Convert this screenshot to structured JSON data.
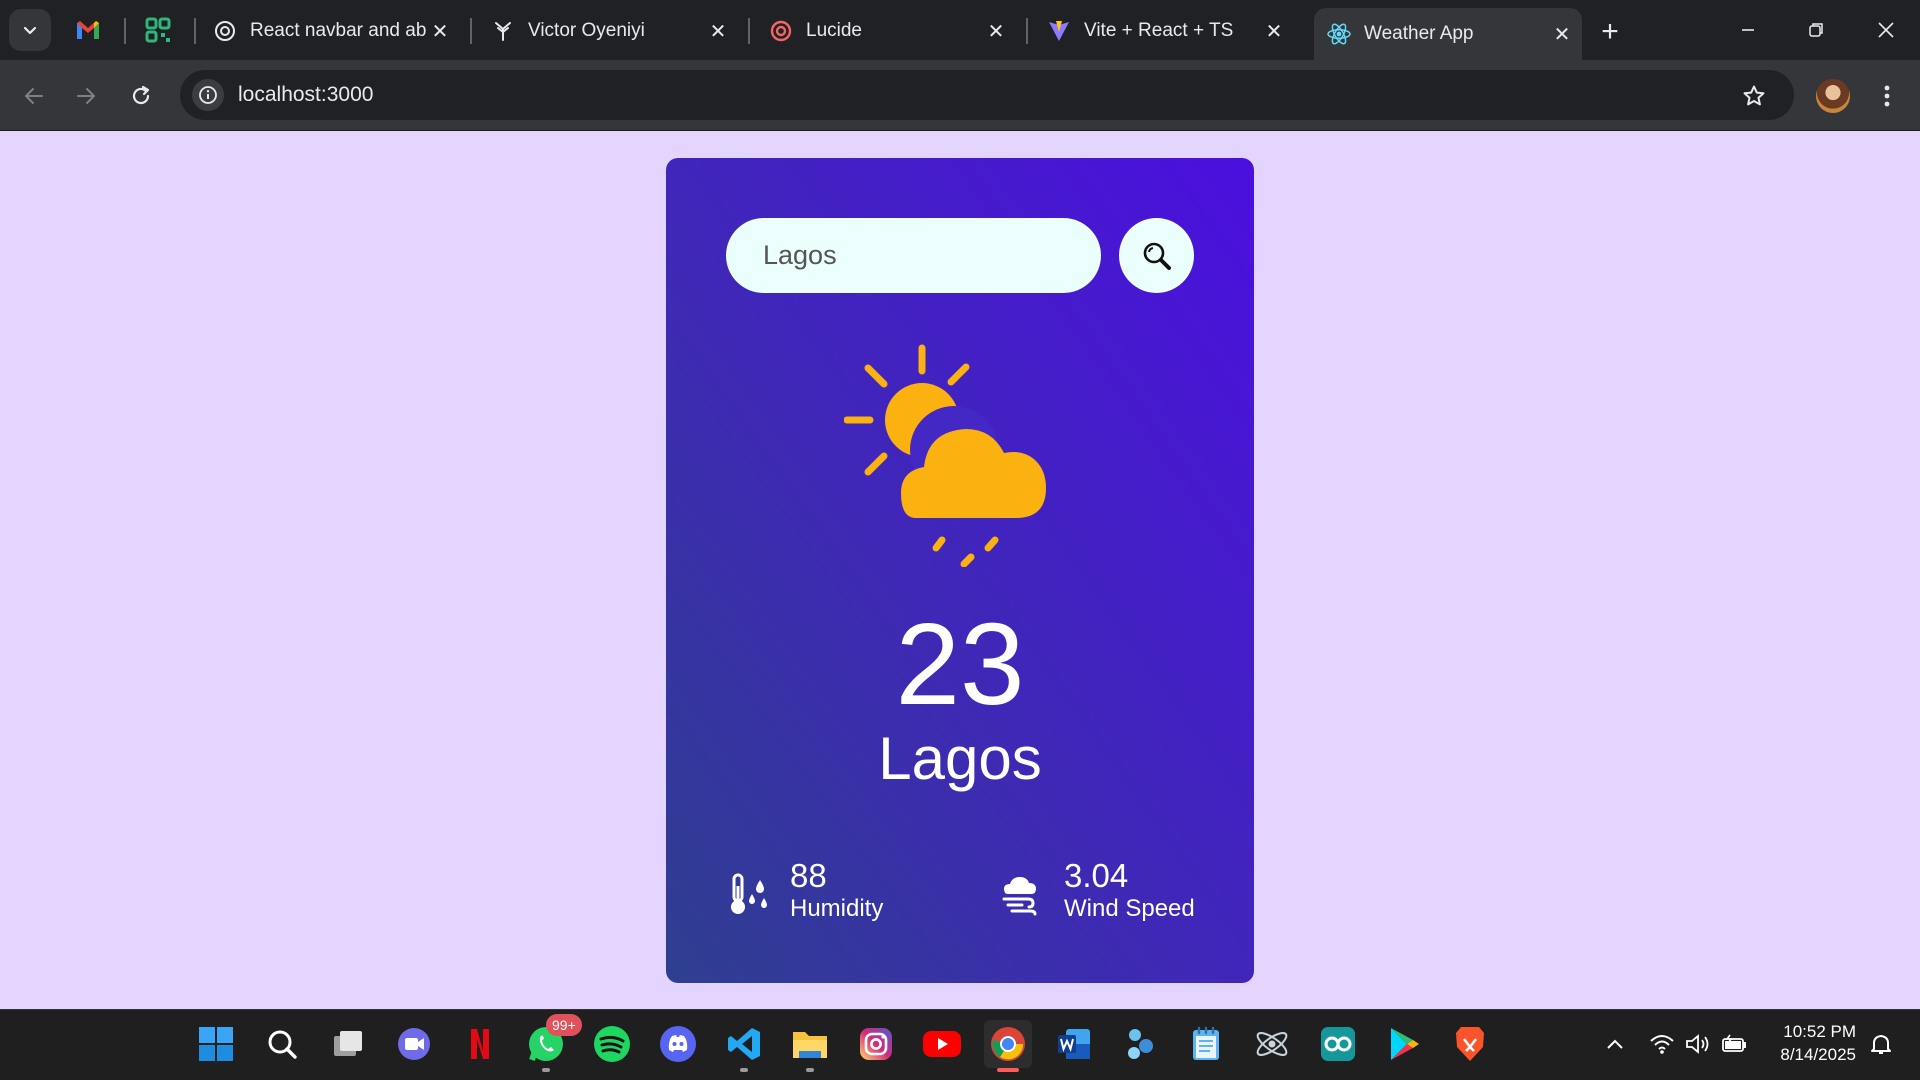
{
  "browser": {
    "tabs": [
      {
        "title": "React navbar and abo",
        "icon": "openai-icon"
      },
      {
        "title": "Victor Oyeniyi",
        "icon": "site-icon"
      },
      {
        "title": "Lucide",
        "icon": "lucide-icon"
      },
      {
        "title": "Vite + React + TS",
        "icon": "vite-icon"
      },
      {
        "title": "Weather App",
        "icon": "react-icon",
        "active": true
      }
    ],
    "pinned_tabs": [
      "gmail-icon",
      "qr-icon"
    ],
    "url": "localhost:3000"
  },
  "weather": {
    "search": {
      "value": "Lagos",
      "placeholder": "Search"
    },
    "temperature": "23",
    "city": "Lagos",
    "condition_icon": "sun-cloud-rain-icon",
    "humidity": {
      "value": "88",
      "label": "Humidity"
    },
    "wind": {
      "value": "3.04",
      "label": "Wind Speed"
    }
  },
  "taskbar": {
    "apps": [
      "start",
      "search",
      "task-view",
      "meet",
      "netflix",
      "whatsapp",
      "spotify",
      "discord",
      "vscode",
      "file-explorer",
      "instagram",
      "youtube",
      "chrome",
      "word",
      "app",
      "notepad",
      "app",
      "arduino",
      "play",
      "brave"
    ],
    "whatsapp_badge": "99+",
    "time": "10:52 PM",
    "date": "8/14/2025"
  },
  "colors": {
    "page_bg": "#e3d5ff",
    "card_top": "#4b0fdf",
    "card_bottom": "#2e3f8f",
    "search_bg": "#ebfffc",
    "sun": "#fbb10f"
  }
}
